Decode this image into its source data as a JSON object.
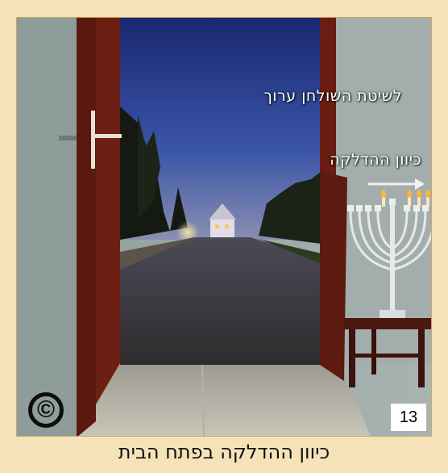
{
  "figure": {
    "heading_text": "לשיטת השולחן ערוך",
    "direction_label": "כיוון ההדלקה",
    "number": "13",
    "copyright_symbol": "©"
  },
  "caption": "כיוון ההדלקה בפתח הבית",
  "colors": {
    "background": "#f6e2b8",
    "wall": "#9aa7a5",
    "door": "#6e1f14",
    "sky": "#243a8a",
    "text": "#ffffff"
  },
  "icons": [
    "copyright-icon",
    "arrow-right-icon",
    "menorah-icon"
  ]
}
